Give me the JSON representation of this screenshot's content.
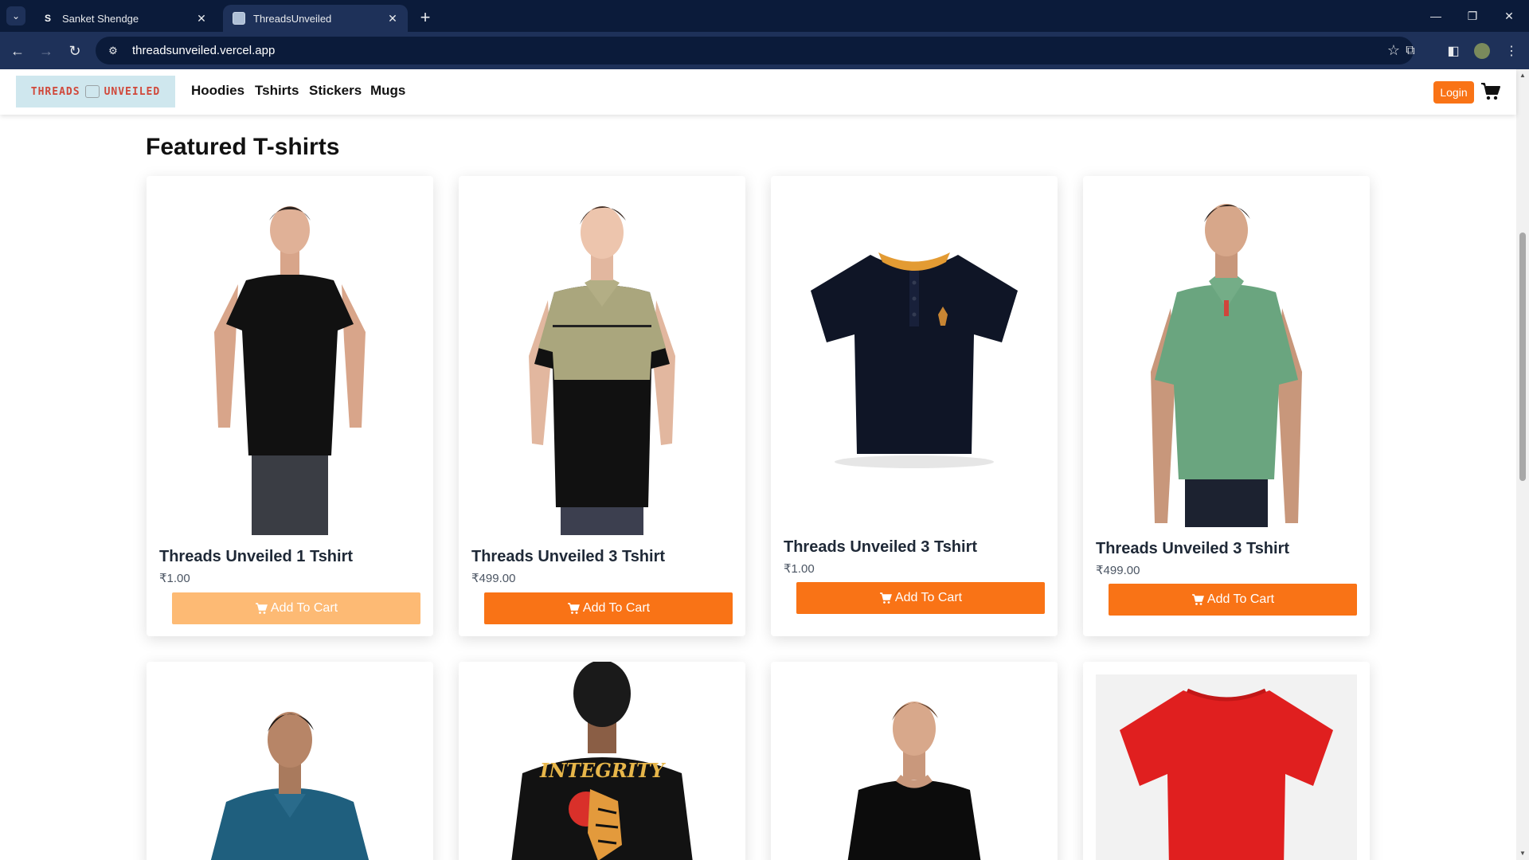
{
  "browser": {
    "tabs": [
      {
        "title": "Sanket Shendge",
        "favicon": "S"
      },
      {
        "title": "ThreadsUnveiled",
        "favicon": ""
      }
    ],
    "url": "threadsunveiled.vercel.app",
    "icons": {
      "tab_search": "chevron-down-icon",
      "new_tab": "plus-icon",
      "back": "arrow-left-icon",
      "forward": "arrow-right-icon",
      "reload": "reload-icon",
      "site_info": "site-settings-icon",
      "bookmark": "star-icon",
      "extensions": "puzzle-icon",
      "side_panel": "side-panel-icon",
      "profile": "avatar",
      "menu": "kebab-menu-icon"
    }
  },
  "site": {
    "logo_text_left": "THREADS",
    "logo_text_right": "UNVEILED",
    "nav": [
      "Hoodies",
      "Tshirts",
      "Stickers",
      "Mugs"
    ],
    "login_label": "Login",
    "accent": "#f97316",
    "accent_faded": "#fdba74"
  },
  "main": {
    "section_title": "Featured T-shirts",
    "products": [
      {
        "name": "Threads Unveiled 1 Tshirt",
        "price": "₹1.00",
        "button": "Add To Cart",
        "image": "man-black-tshirt",
        "button_faded": true
      },
      {
        "name": "Threads Unveiled 3 Tshirt",
        "price": "₹499.00",
        "button": "Add To Cart",
        "image": "man-olive-black-polo",
        "button_faded": false
      },
      {
        "name": "Threads Unveiled 3 Tshirt",
        "price": "₹1.00",
        "button": "Add To Cart",
        "image": "navy-polo-flatlay",
        "button_faded": false
      },
      {
        "name": "Threads Unveiled 3 Tshirt",
        "price": "₹499.00",
        "button": "Add To Cart",
        "image": "man-green-polo",
        "button_faded": false
      }
    ],
    "row2_images": [
      "man-teal-polo",
      "man-back-integrity-tiger-print",
      "man-black-crew-tshirt",
      "red-tshirt-flatlay"
    ]
  }
}
